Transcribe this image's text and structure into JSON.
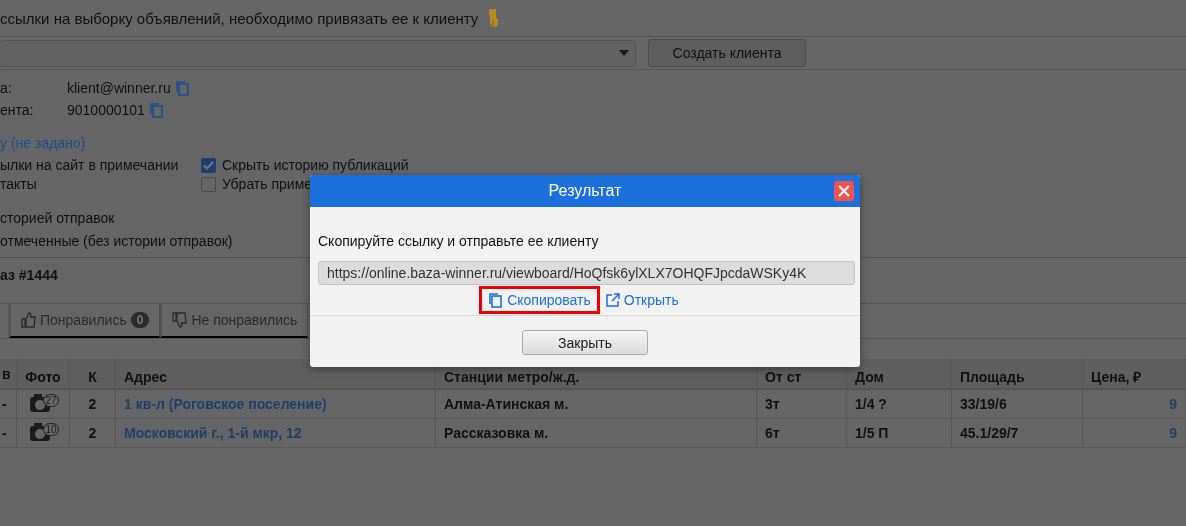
{
  "notice": {
    "text": "ссылки на выборку объявлений, необходимо привязать ее к клиенту"
  },
  "create_client_button": "Создать клиента",
  "contacts": [
    {
      "label": "а:",
      "value": "klient@winner.ru"
    },
    {
      "label": "ента:",
      "value": "9010000101"
    }
  ],
  "link": "у (не задано)",
  "options_left": [
    "ылки на сайт в примечании",
    "такты"
  ],
  "checkboxes": [
    {
      "label": "Скрыть историю публикаций",
      "checked": true
    },
    {
      "label": "Убрать приме",
      "checked": false
    }
  ],
  "send_options": [
    "сторией отправок",
    "отмеченные (без истории отправок)"
  ],
  "order_title": "аз #1444",
  "tabs": [
    {
      "kind": "liked",
      "label": "Понравились",
      "count": "0"
    },
    {
      "kind": "disliked",
      "label": "Не понравились"
    }
  ],
  "table": {
    "columns": [
      "в",
      "Фото",
      "К",
      "Адрес",
      "Станции метро/ж.д.",
      "От ст",
      "Дом",
      "Площадь",
      "Цена, ₽"
    ],
    "rows": [
      {
        "cells": [
          "-",
          "27",
          "2",
          "1 кв-л (Роговское поселение)",
          "Алма-Атинская м.",
          "3т",
          "1/4 ?",
          "33/19/6",
          "9"
        ]
      },
      {
        "cells": [
          "-",
          "10",
          "2",
          "Московский г., 1-й мкр, 12",
          "Рассказовка м.",
          "6т",
          "1/5 П",
          "45.1/29/7",
          "9"
        ]
      }
    ]
  },
  "dialog": {
    "title": "Результат",
    "message": "Скопируйте ссылку и отправьте ее клиенту",
    "url": "https://online.baza-winner.ru/viewboard/HoQfsk6ylXLX7OHQFJpcdaWSKy4K",
    "copy_link": "Скопировать",
    "copy_highlighted": true,
    "open_link": "Открыть",
    "close_button": "Закрыть"
  }
}
